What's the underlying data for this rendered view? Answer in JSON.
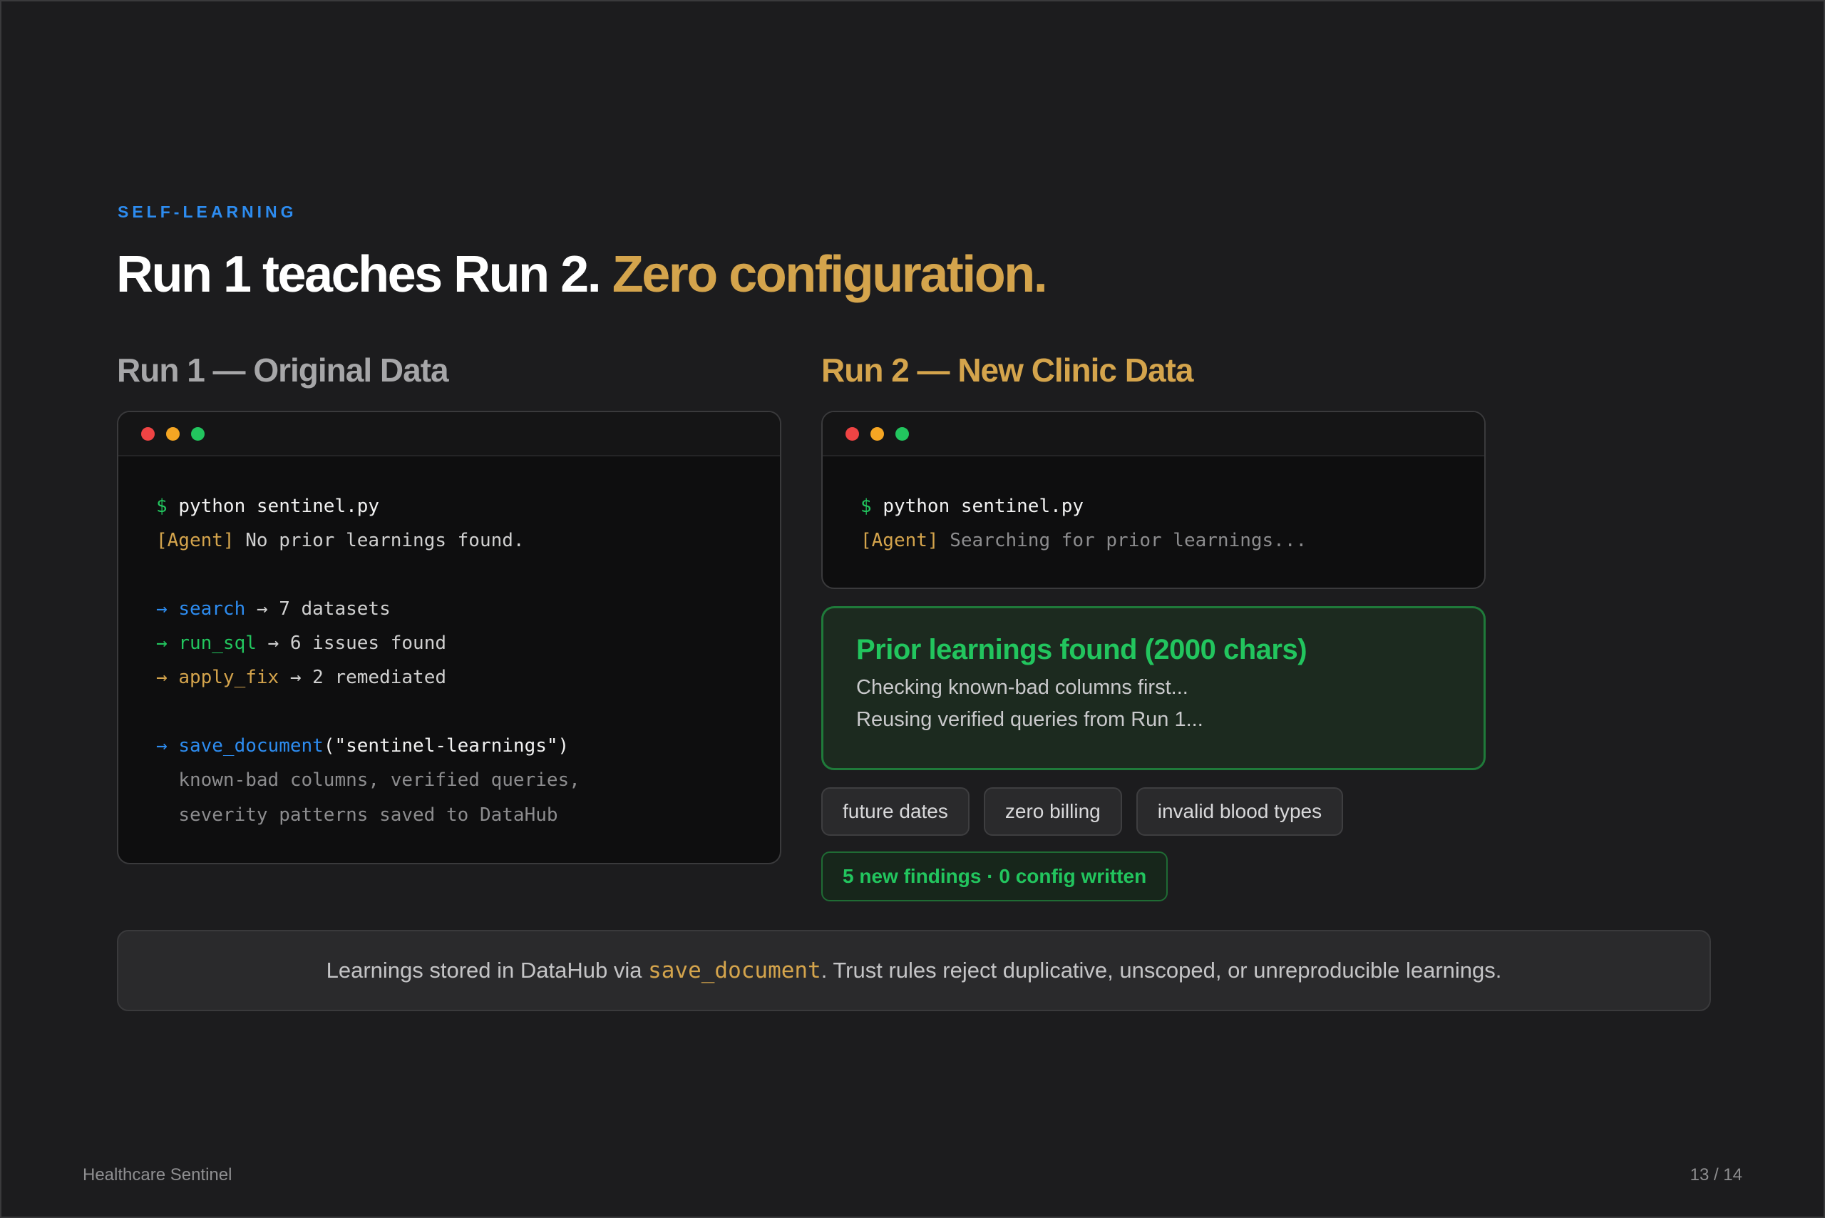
{
  "slide": {
    "eyebrow": "SELF-LEARNING",
    "headline_main": "Run 1 teaches Run 2.",
    "headline_accent": "Zero configuration."
  },
  "run1": {
    "title": "Run 1 — Original Data",
    "lines": {
      "prompt": "$",
      "command": "python sentinel.py",
      "agent_tag": "[Agent]",
      "agent_msg": "No prior learnings found.",
      "arrow": "→",
      "step1_tool": "search",
      "step1_result": "→ 7 datasets",
      "step2_tool": "run_sql",
      "step2_result": "→ 6 issues found",
      "step3_tool": "apply_fix",
      "step3_result": "→ 2 remediated",
      "save_tool": "save_document",
      "save_arg": "(\"sentinel-learnings\")",
      "save_detail1": "known-bad columns, verified queries,",
      "save_detail2": "severity patterns saved to DataHub"
    }
  },
  "run2": {
    "title": "Run 2 — New Clinic Data",
    "lines": {
      "prompt": "$",
      "command": "python sentinel.py",
      "agent_tag": "[Agent]",
      "agent_msg": "Searching for prior learnings..."
    },
    "found": {
      "title": "Prior learnings found (2000 chars)",
      "line1": "Checking known-bad columns first...",
      "line2": "Reusing verified queries from Run 1..."
    },
    "chips": [
      "future dates",
      "zero billing",
      "invalid blood types"
    ],
    "status": "5 new findings · 0 config written"
  },
  "note": {
    "prefix": "Learnings stored in DataHub via ",
    "code": "save_document",
    "suffix": ". Trust rules reject duplicative, unscoped, or unreproducible learnings."
  },
  "footer": {
    "brand": "Healthcare Sentinel",
    "page": "13 / 14"
  },
  "colors": {
    "accent_gold": "#d4a44c",
    "accent_blue": "#2d8cf0",
    "success_green": "#22c55e",
    "background": "#1c1c1e"
  }
}
